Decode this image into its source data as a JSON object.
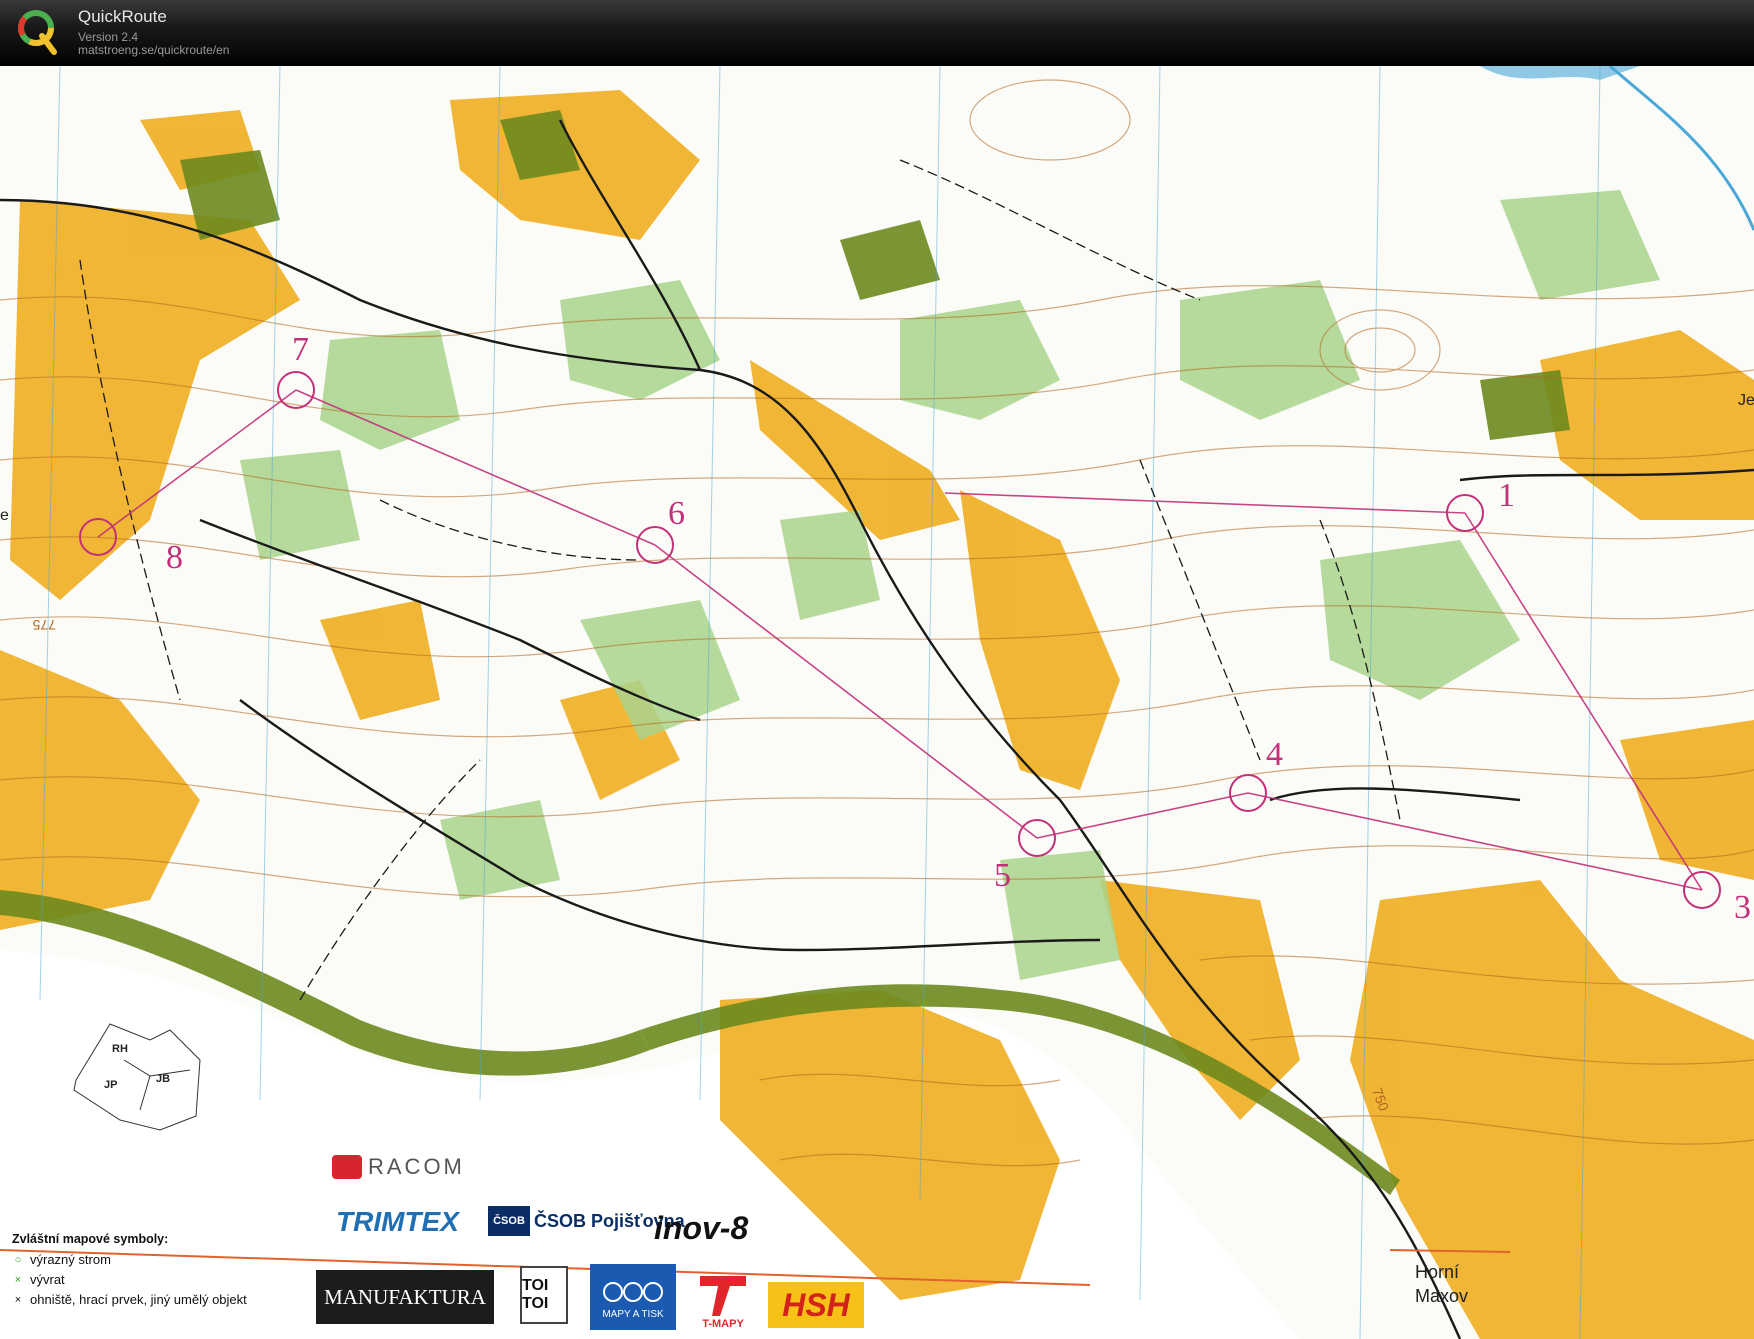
{
  "app": {
    "title": "QuickRoute",
    "version": "Version 2.4",
    "url": "matstroeng.se/quickroute/en"
  },
  "colors": {
    "header_bg": "#000000",
    "open_land": "#f0b22a",
    "forest_green": "#a9d38c",
    "dark_green": "#6d8a1e",
    "course_magenta": "#c2307a",
    "contour_brown": "#b5651d",
    "water_blue": "#4aa8d8"
  },
  "controls": [
    {
      "label": "1",
      "pos": [
        1465,
        513
      ]
    },
    {
      "label": "3",
      "pos": [
        1702,
        890
      ]
    },
    {
      "label": "4",
      "pos": [
        1248,
        793
      ]
    },
    {
      "label": "5",
      "pos": [
        1037,
        838
      ]
    },
    {
      "label": "6",
      "pos": [
        655,
        545
      ]
    },
    {
      "label": "7",
      "pos": [
        296,
        390
      ]
    },
    {
      "label": "8",
      "pos": [
        98,
        537
      ]
    }
  ],
  "map_labels": {
    "regions": [
      "RH",
      "JP",
      "JB"
    ],
    "contour_height": "750",
    "contour_height_2": "775",
    "edge_letter": "Je",
    "edge_letter_2": "e"
  },
  "legend": {
    "title": "Zvláštní mapové symboly:",
    "items": [
      {
        "symbol": "○",
        "color": "#3c9a2a",
        "label": "výrazný strom"
      },
      {
        "symbol": "×",
        "color": "#3c9a2a",
        "label": "vývrat"
      },
      {
        "symbol": "×",
        "color": "#111111",
        "label": "ohniště, hrací prvek, jiný umělý objekt"
      }
    ]
  },
  "sponsors": {
    "racom": "RACOM",
    "trimtex": "TRIMTEX",
    "csob": "ČSOB Pojišťovna",
    "inov": "inov-8",
    "manufaktura": "MANUFAKTURA",
    "toitoi": "TOI TOI",
    "zaket": "MAPY A TISK",
    "tmapy": "T-MAPY",
    "hsh": "HSH"
  },
  "place": {
    "line1": "Horní",
    "line2": "Maxov"
  }
}
